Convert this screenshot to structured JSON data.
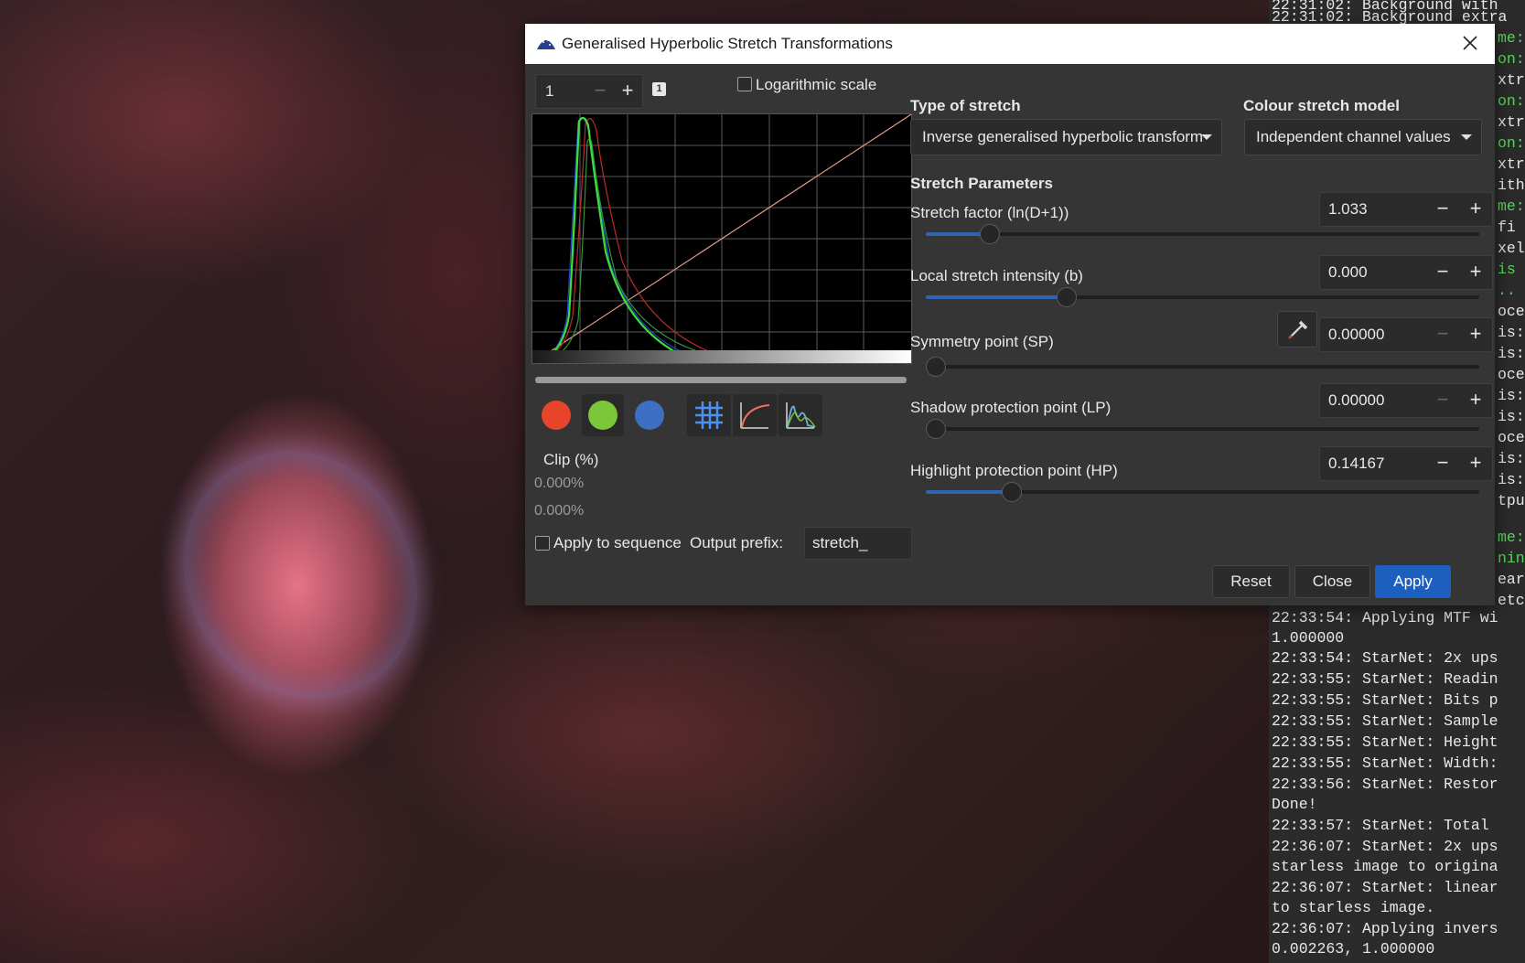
{
  "dialog": {
    "title": "Generalised Hyperbolic Stretch Transformations",
    "zoom_value": "1",
    "zoom_badge": "1",
    "log_scale_label": "Logarithmic scale",
    "clip_label": "Clip (%)",
    "clip_low": "0.000%",
    "clip_high": "0.000%",
    "apply_sequence_label": "Apply to sequence",
    "output_prefix_label": "Output prefix:",
    "output_prefix_value": "stretch_",
    "type_of_stretch_header": "Type of stretch",
    "type_of_stretch_value": "Inverse generalised hyperbolic transform",
    "colour_model_header": "Colour stretch model",
    "colour_model_value": "Independent channel values",
    "stretch_params_header": "Stretch Parameters",
    "params": [
      {
        "label": "Stretch factor (ln(D+1))",
        "value": "1.033",
        "slider_fraction": 0.1
      },
      {
        "label": "Local stretch intensity (b)",
        "value": "0.000",
        "slider_fraction": 0.245
      },
      {
        "label": "Symmetry point (SP)",
        "value": "0.00000",
        "slider_fraction": 0.0
      },
      {
        "label": "Shadow protection point (LP)",
        "value": "0.00000",
        "slider_fraction": 0.0
      },
      {
        "label": "Highlight protection point (HP)",
        "value": "0.14167",
        "slider_fraction": 0.14167
      }
    ],
    "buttons": {
      "reset": "Reset",
      "close": "Close",
      "apply": "Apply"
    },
    "channel_colors": {
      "red": "#e8442c",
      "green": "#7cc63a",
      "blue": "#3e6fc2"
    },
    "accent": "#1c5fbf"
  },
  "console": {
    "lines": [
      {
        "text": "22:31:02: Background with",
        "color": "white"
      },
      {
        "text": "22:31:02: Background extra",
        "color": "white"
      },
      {
        "text": "me:",
        "color": "green"
      },
      {
        "text": "on:",
        "color": "green"
      },
      {
        "text": "xtr",
        "color": "white"
      },
      {
        "text": "on:",
        "color": "green"
      },
      {
        "text": "xtr",
        "color": "white"
      },
      {
        "text": "on:",
        "color": "green"
      },
      {
        "text": "xtr",
        "color": "white"
      },
      {
        "text": "ith",
        "color": "white"
      },
      {
        "text": "me:",
        "color": "green"
      },
      {
        "text": " fi",
        "color": "white"
      },
      {
        "text": "xel",
        "color": "white"
      },
      {
        "text": "is",
        "color": "green"
      },
      {
        "text": "..",
        "color": "green"
      },
      {
        "text": "oce",
        "color": "white"
      },
      {
        "text": "is:",
        "color": "white"
      },
      {
        "text": "is:",
        "color": "white"
      },
      {
        "text": "oce",
        "color": "white"
      },
      {
        "text": "is:",
        "color": "white"
      },
      {
        "text": "is:",
        "color": "white"
      },
      {
        "text": "oce",
        "color": "white"
      },
      {
        "text": "is:",
        "color": "white"
      },
      {
        "text": "is:",
        "color": "white"
      },
      {
        "text": "tpu",
        "color": "white"
      },
      {
        "text": "me:",
        "color": "green"
      },
      {
        "text": "nin",
        "color": "green"
      },
      {
        "text": "ear",
        "color": "white"
      },
      {
        "text": "etc",
        "color": "white"
      },
      {
        "text": "22:33:54: Applying MTF wi",
        "color": "white"
      },
      {
        "text": "1.000000",
        "color": "white"
      },
      {
        "text": "22:33:54: StarNet: 2x ups",
        "color": "white"
      },
      {
        "text": "22:33:55: StarNet: Readin",
        "color": "white"
      },
      {
        "text": "22:33:55: StarNet: Bits p",
        "color": "white"
      },
      {
        "text": "22:33:55: StarNet: Sample",
        "color": "white"
      },
      {
        "text": "22:33:55: StarNet: Height",
        "color": "white"
      },
      {
        "text": "22:33:55: StarNet: Width:",
        "color": "white"
      },
      {
        "text": "22:33:56: StarNet: Restor",
        "color": "white"
      },
      {
        "text": "Done!",
        "color": "white"
      },
      {
        "text": "22:33:57: StarNet: Total",
        "color": "white"
      },
      {
        "text": "22:36:07: StarNet: 2x ups",
        "color": "white"
      },
      {
        "text": "starless image to origina",
        "color": "white"
      },
      {
        "text": "22:36:07: StarNet: linear",
        "color": "white"
      },
      {
        "text": "to starless image.",
        "color": "white"
      },
      {
        "text": "22:36:07: Applying invers",
        "color": "white"
      },
      {
        "text": "0.002263, 1.000000",
        "color": "white"
      }
    ]
  }
}
